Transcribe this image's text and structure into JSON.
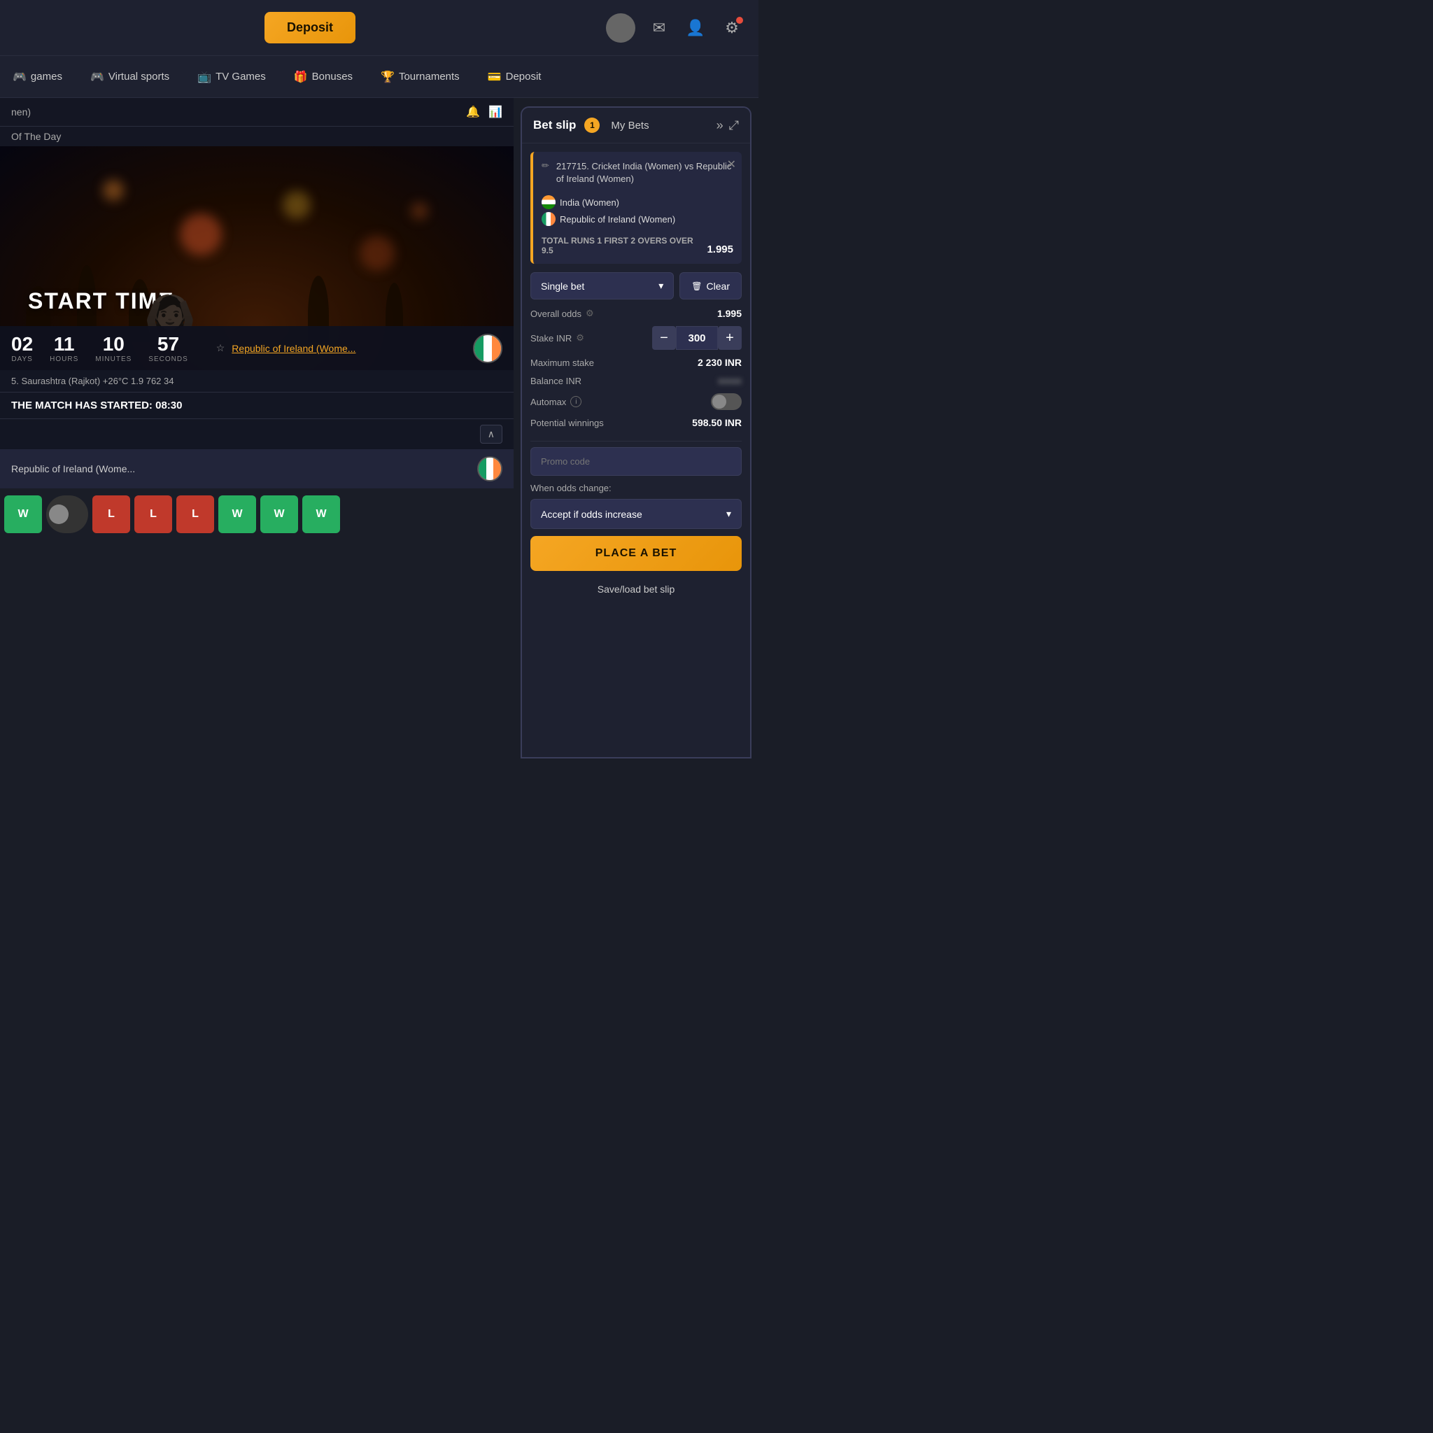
{
  "header": {
    "deposit_label": "Deposit",
    "avatar_blur": true
  },
  "nav": {
    "items": [
      {
        "id": "games",
        "label": "games",
        "icon": "🎮"
      },
      {
        "id": "virtual-sports",
        "label": "Virtual sports",
        "icon": "🎮"
      },
      {
        "id": "tv-games",
        "label": "TV Games",
        "icon": "📺"
      },
      {
        "id": "bonuses",
        "label": "Bonuses",
        "icon": "🎁"
      },
      {
        "id": "tournaments",
        "label": "Tournaments",
        "icon": "🏆"
      },
      {
        "id": "deposit-nav",
        "label": "Deposit",
        "icon": "💳"
      }
    ]
  },
  "match": {
    "label_women": "Republic of Ireland (Wome...",
    "started_text": "THE MATCH HAS STARTED: 08:30",
    "weather": "5. Saurashtra (Rajkot)  +26°C  1.9  762  34",
    "timer": {
      "days": "02",
      "hours": "11",
      "minutes": "10",
      "seconds": "57",
      "days_label": "DAYS",
      "hours_label": "HOURS",
      "minutes_label": "MINUTES",
      "seconds_label": "SECONDS"
    },
    "hero_title": "START TIME"
  },
  "results": [
    "W",
    "L",
    "L",
    "L",
    "W",
    "W",
    "W"
  ],
  "bet_slip": {
    "title": "Bet slip",
    "count": "1",
    "my_bets_label": "My Bets",
    "bet_item": {
      "match_id": "217715. Cricket India (Women) vs Republic of Ireland (Women)",
      "team1": "India (Women)",
      "team2": "Republic of Ireland (Women)",
      "market": "TOTAL RUNS 1 FIRST 2 OVERS OVER 9.5",
      "odds": "1.995"
    },
    "controls": {
      "bet_type": "Single bet",
      "clear_label": "Clear",
      "overall_odds_label": "Overall odds",
      "overall_odds_value": "1.995",
      "stake_label": "Stake INR",
      "stake_value": "300",
      "max_stake_label": "Maximum stake",
      "max_stake_value": "2 230 INR",
      "balance_label": "Balance INR",
      "balance_value": "●●●●",
      "automax_label": "Automax",
      "potential_label": "Potential winnings",
      "potential_value": "598.50 INR",
      "promo_placeholder": "Promo code",
      "when_odds_label": "When odds change:",
      "accept_odds_label": "Accept if odds increase",
      "place_bet_label": "PLACE A BET",
      "save_load_label": "Save/load bet slip"
    }
  }
}
